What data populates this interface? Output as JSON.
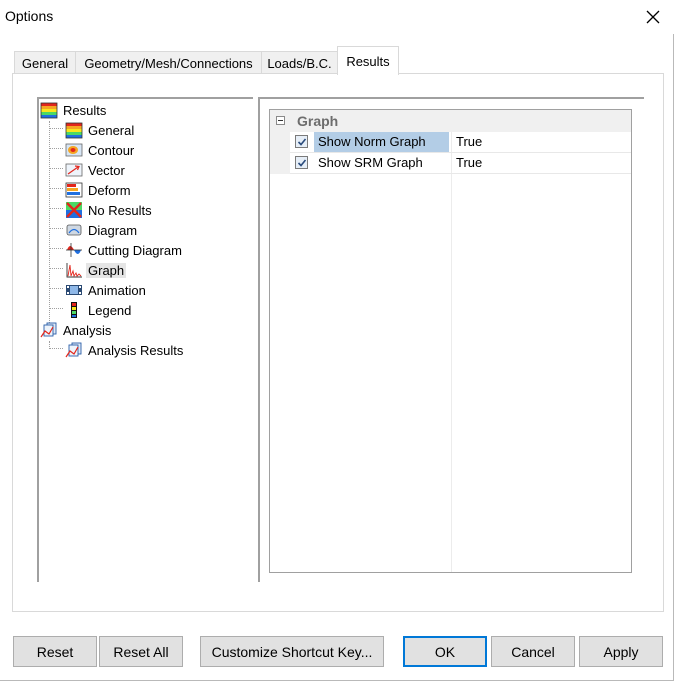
{
  "window": {
    "title": "Options"
  },
  "tabs": [
    {
      "label": "General"
    },
    {
      "label": "Geometry/Mesh/Connections"
    },
    {
      "label": "Loads/B.C."
    },
    {
      "label": "Results"
    }
  ],
  "active_tab": "Results",
  "tree": {
    "root": {
      "label": "Results",
      "icon": "results-spectrum-icon"
    },
    "children": [
      {
        "label": "General",
        "icon": "spectrum-icon"
      },
      {
        "label": "Contour",
        "icon": "contour-icon"
      },
      {
        "label": "Vector",
        "icon": "vector-icon"
      },
      {
        "label": "Deform",
        "icon": "deform-icon"
      },
      {
        "label": "No Results",
        "icon": "no-results-icon"
      },
      {
        "label": "Diagram",
        "icon": "diagram-icon"
      },
      {
        "label": "Cutting Diagram",
        "icon": "cutting-diagram-icon"
      },
      {
        "label": "Graph",
        "icon": "graph-icon"
      },
      {
        "label": "Animation",
        "icon": "animation-icon"
      },
      {
        "label": "Legend",
        "icon": "legend-icon"
      }
    ],
    "root2": {
      "label": "Analysis",
      "icon": "analysis-icon"
    },
    "children2": [
      {
        "label": "Analysis Results",
        "icon": "analysis-results-icon"
      }
    ],
    "selected": "Graph"
  },
  "property_grid": {
    "category": "Graph",
    "rows": [
      {
        "name": "Show Norm Graph",
        "value": "True",
        "checked": true
      },
      {
        "name": "Show SRM Graph",
        "value": "True",
        "checked": true
      }
    ]
  },
  "buttons": {
    "reset": "Reset",
    "reset_all": "Reset All",
    "customize": "Customize Shortcut Key...",
    "ok": "OK",
    "cancel": "Cancel",
    "apply": "Apply"
  }
}
